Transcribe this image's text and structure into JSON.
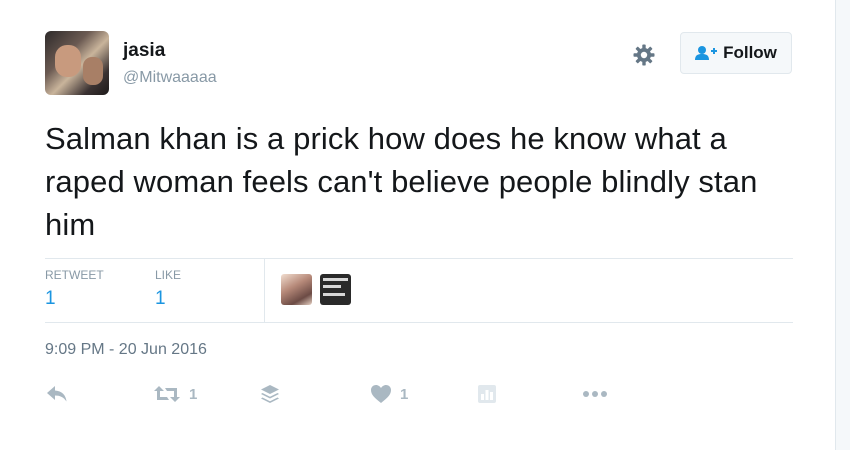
{
  "tweet": {
    "name": "jasia",
    "handle": "@Mitwaaaaa",
    "follow_label": "Follow",
    "text": "Salman khan is a prick how does he know what a raped woman feels can't believe people blindly stan him",
    "timestamp": "9:09 PM - 20 Jun 2016"
  },
  "stats": {
    "retweet_label": "RETWEET",
    "retweet_count": "1",
    "like_label": "LIKE",
    "like_count": "1"
  },
  "actions": {
    "retweet_count": "1",
    "like_count": "1"
  },
  "icons": {
    "settings": "gear-icon",
    "follow": "follow-user-icon",
    "reply": "reply-icon",
    "retweet": "retweet-icon",
    "buffer": "stack-icon",
    "like": "heart-icon",
    "analytics": "analytics-icon",
    "more": "more-icon"
  },
  "colors": {
    "accent": "#1b95e0",
    "muted": "#8899a6",
    "icon": "#aab8c2"
  }
}
